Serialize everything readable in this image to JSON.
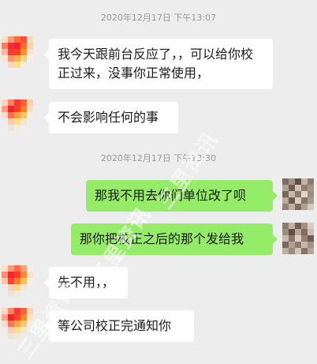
{
  "timestamps": {
    "first": "2020年12月17日 下午13:07",
    "second": "2020年12月17日 下午13:30"
  },
  "messages": [
    {
      "side": "in",
      "text": "我今天跟前台反应了，，可以给你校正过来，没事你正常使用，"
    },
    {
      "side": "in",
      "text": "不会影响任何的事"
    },
    {
      "side": "out",
      "text": "那我不用去你们单位改了呗"
    },
    {
      "side": "out",
      "text": "那你把校正之后的那个发给我"
    },
    {
      "side": "in",
      "text": "先不用，，"
    },
    {
      "side": "in",
      "text": "等公司校正完通知你"
    }
  ],
  "watermark": {
    "text": "三里资讯"
  },
  "colors": {
    "background": "#ededed",
    "incoming_bubble": "#ffffff",
    "outgoing_bubble": "#95ec69",
    "timestamp_text": "#9a9a9a"
  }
}
